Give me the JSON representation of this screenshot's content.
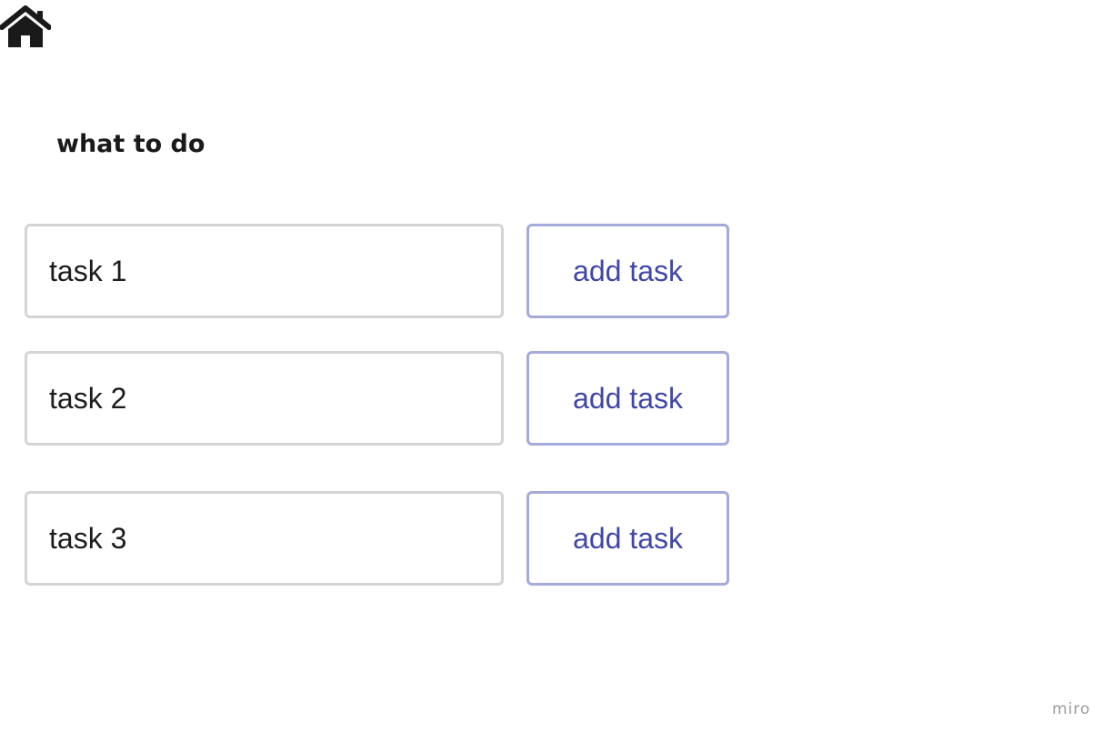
{
  "header": {
    "home_icon": "home-icon"
  },
  "page": {
    "title": "what to do"
  },
  "tasks": [
    {
      "value": "task 1",
      "button_label": "add task"
    },
    {
      "value": "task 2",
      "button_label": "add task"
    },
    {
      "value": "task 3",
      "button_label": "add task"
    }
  ],
  "footer": {
    "brand": "miro"
  },
  "colors": {
    "input_border": "#d4d4d4",
    "button_border": "#a4aad9",
    "button_text": "#4146a8",
    "text": "#1c1c1c"
  }
}
